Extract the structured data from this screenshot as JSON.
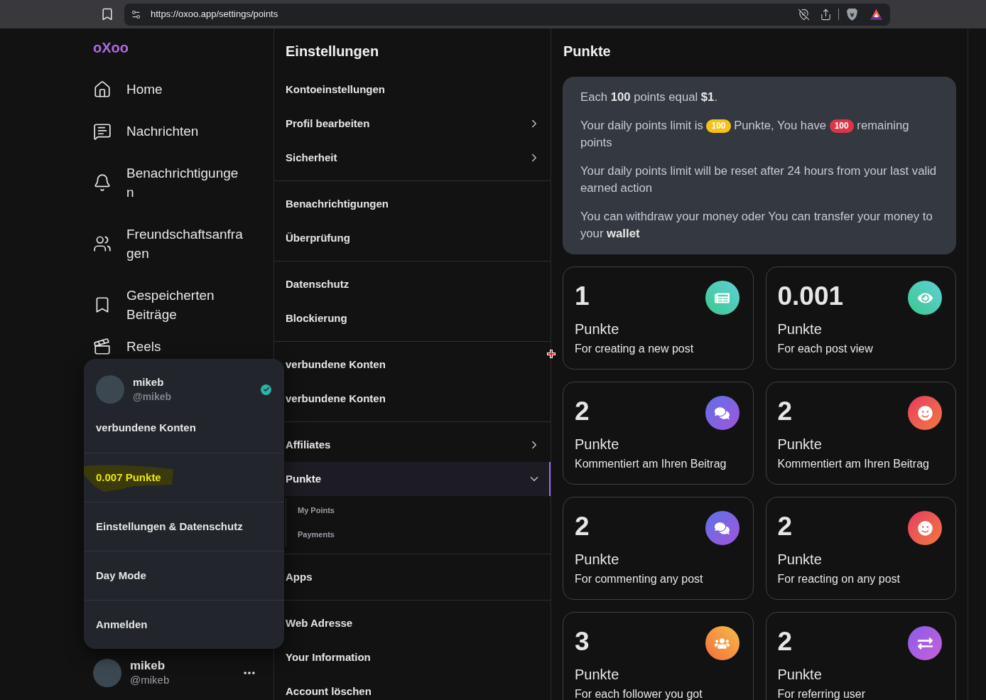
{
  "browser": {
    "url": "https://oxoo.app/settings/points"
  },
  "sidebar": {
    "logo": "oXoo",
    "items": [
      {
        "kind": "home",
        "label": "Home"
      },
      {
        "kind": "messages",
        "label": "Nachrichten"
      },
      {
        "kind": "bell",
        "label": "Benachrichtigungen"
      },
      {
        "kind": "friends",
        "label": "Freundschaftsanfragen"
      },
      {
        "kind": "saved",
        "label": "Gespeicherten Beiträge"
      },
      {
        "kind": "reels",
        "label": "Reels"
      }
    ],
    "user": {
      "name": "mikeb",
      "handle": "@mikeb"
    }
  },
  "account_menu": {
    "user": {
      "name": "mikeb",
      "handle": "@mikeb",
      "verified": true
    },
    "items": [
      {
        "kind": "link",
        "label": "verbundene Konten"
      },
      {
        "kind": "points",
        "label": "0.007 Punkte"
      },
      {
        "kind": "link",
        "label": "Einstellungen & Datenschutz"
      },
      {
        "kind": "link",
        "label": "Day Mode"
      },
      {
        "kind": "link",
        "label": "Anmelden"
      }
    ]
  },
  "settings": {
    "title": "Einstellungen",
    "groups": [
      {
        "items": [
          {
            "label": "Kontoeinstellungen",
            "selected": false,
            "expandable": false
          },
          {
            "label": "Profil bearbeiten",
            "selected": false,
            "expandable": true,
            "expanded": false
          },
          {
            "label": "Sicherheit",
            "selected": false,
            "expandable": true,
            "expanded": false
          }
        ]
      },
      {
        "items": [
          {
            "label": "Benachrichtigungen",
            "selected": false,
            "expandable": false
          },
          {
            "label": "Überprüfung",
            "selected": false,
            "expandable": false
          }
        ]
      },
      {
        "items": [
          {
            "label": "Datenschutz",
            "selected": false,
            "expandable": false
          },
          {
            "label": "Blockierung",
            "selected": false,
            "expandable": false
          }
        ]
      },
      {
        "items": [
          {
            "label": "verbundene Konten",
            "selected": false,
            "expandable": false
          },
          {
            "label": "verbundene Konten",
            "selected": false,
            "expandable": false
          }
        ]
      },
      {
        "items": [
          {
            "label": "Affiliates",
            "selected": false,
            "expandable": true,
            "expanded": false
          },
          {
            "label": "Punkte",
            "selected": true,
            "expandable": true,
            "expanded": true,
            "children": [
              {
                "label": "My Points",
                "selected": false
              },
              {
                "label": "Payments",
                "selected": false
              }
            ]
          }
        ]
      },
      {
        "items": [
          {
            "label": "Apps",
            "selected": false,
            "expandable": false
          }
        ]
      },
      {
        "items": [
          {
            "label": "Web Adresse",
            "selected": false,
            "expandable": false
          },
          {
            "label": "Your Information",
            "selected": false,
            "expandable": false
          },
          {
            "label": "Account löschen",
            "selected": false,
            "expandable": false
          }
        ]
      }
    ]
  },
  "points": {
    "title": "Punkte",
    "info": [
      {
        "parts": [
          {
            "kind": "text",
            "text": "Each **100** points equal **$1**."
          }
        ]
      },
      {
        "parts": [
          {
            "kind": "text",
            "text": "Your daily points limit is"
          },
          {
            "kind": "badge",
            "text": "100",
            "color": "#f5c21b"
          },
          {
            "kind": "text",
            "text": "Punkte, You have"
          },
          {
            "kind": "badge",
            "text": "100",
            "color": "#dc3545"
          },
          {
            "kind": "text",
            "text": "remaining"
          },
          {
            "kind": "text",
            "text": "points"
          }
        ]
      },
      {
        "parts": [
          {
            "kind": "text",
            "text": "Your daily points limit will be reset after 24 hours from your last valid earned action"
          }
        ]
      },
      {
        "parts": [
          {
            "kind": "text",
            "text": "You can withdraw your money oder You can transfer your money to your **wallet**"
          }
        ]
      }
    ],
    "cards": [
      {
        "kind": "newspaper",
        "value": "1",
        "unit": "Punkte",
        "description": "For creating a new post"
      },
      {
        "kind": "eye",
        "value": "0.001",
        "unit": "Punkte",
        "description": "For each post view"
      },
      {
        "kind": "chat",
        "value": "2",
        "unit": "Punkte",
        "description": "Kommentiert am Ihren Beitrag"
      },
      {
        "kind": "smile",
        "value": "2",
        "unit": "Punkte",
        "description": "Kommentiert am Ihren Beitrag"
      },
      {
        "kind": "chat",
        "value": "2",
        "unit": "Punkte",
        "description": "For commenting any post"
      },
      {
        "kind": "smile",
        "value": "2",
        "unit": "Punkte",
        "description": "For reacting on any post"
      },
      {
        "kind": "users",
        "value": "3",
        "unit": "Punkte",
        "description": "For each follower you got"
      },
      {
        "kind": "arrows",
        "value": "2",
        "unit": "Punkte",
        "description": "For referring user"
      }
    ]
  }
}
